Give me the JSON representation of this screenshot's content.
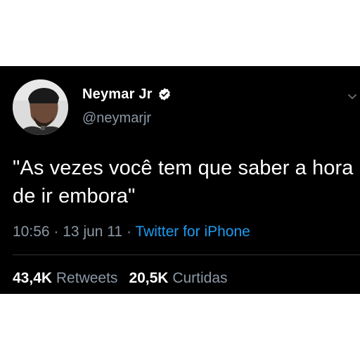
{
  "tweet": {
    "display_name": "Neymar Jr",
    "handle": "@neymarjr",
    "verified": true,
    "text": "\"As vezes você tem que saber a hora de ir embora\"",
    "time": "10:56",
    "date": "13 jun 11",
    "separator": "·",
    "source": "Twitter for iPhone",
    "retweets_count": "43,4K",
    "retweets_label": "Retweets",
    "likes_count": "20,5K",
    "likes_label": "Curtidas"
  },
  "colors": {
    "background": "#000000",
    "text": "#ffffff",
    "muted": "#8b98a5",
    "link": "#1d9bf0",
    "verified_badge": "#ffffff"
  },
  "icons": {
    "verified": "verified-badge-icon",
    "menu": "chevron-down-icon",
    "avatar": "profile-photo"
  }
}
